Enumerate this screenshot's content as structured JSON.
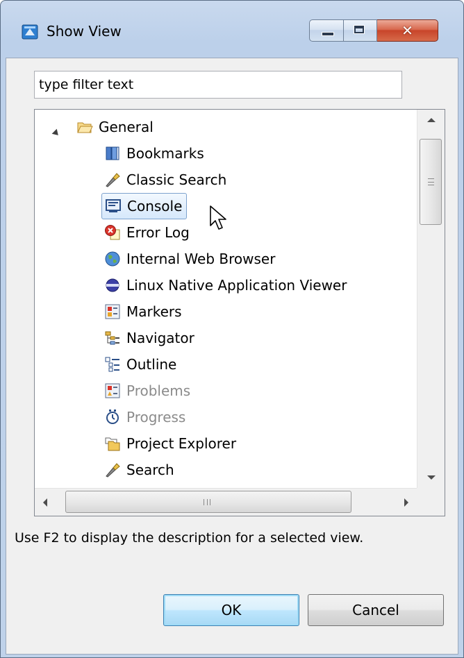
{
  "window": {
    "title": "Show View",
    "controls": {
      "minimize": "minimize",
      "maximize": "maximize",
      "close": "close"
    }
  },
  "filter": {
    "value": "type filter text"
  },
  "tree": {
    "category": {
      "label": "General",
      "expanded": true,
      "icon": "open-folder-icon"
    },
    "items": [
      {
        "label": "Bookmarks",
        "icon": "bookmarks-icon",
        "disabled": false,
        "selected": false
      },
      {
        "label": "Classic Search",
        "icon": "flashlight-icon",
        "disabled": false,
        "selected": false
      },
      {
        "label": "Console",
        "icon": "console-icon",
        "disabled": false,
        "selected": true
      },
      {
        "label": "Error Log",
        "icon": "error-log-icon",
        "disabled": false,
        "selected": false
      },
      {
        "label": "Internal Web Browser",
        "icon": "globe-icon",
        "disabled": false,
        "selected": false
      },
      {
        "label": "Linux Native Application Viewer",
        "icon": "native-app-icon",
        "disabled": false,
        "selected": false
      },
      {
        "label": "Markers",
        "icon": "markers-icon",
        "disabled": false,
        "selected": false
      },
      {
        "label": "Navigator",
        "icon": "navigator-icon",
        "disabled": false,
        "selected": false
      },
      {
        "label": "Outline",
        "icon": "outline-icon",
        "disabled": false,
        "selected": false
      },
      {
        "label": "Problems",
        "icon": "problems-icon",
        "disabled": true,
        "selected": false
      },
      {
        "label": "Progress",
        "icon": "progress-icon",
        "disabled": true,
        "selected": false
      },
      {
        "label": "Project Explorer",
        "icon": "project-explorer-icon",
        "disabled": false,
        "selected": false
      },
      {
        "label": "Search",
        "icon": "flashlight-icon",
        "disabled": false,
        "selected": false
      }
    ]
  },
  "hint": "Use F2 to display the description for a selected view.",
  "buttons": {
    "ok": "OK",
    "cancel": "Cancel"
  },
  "colors": {
    "selection_border": "#7da2ce",
    "selection_fill": "#d6e8fb",
    "disabled_text": "#8b8b8b",
    "close_button": "#c8452a"
  }
}
